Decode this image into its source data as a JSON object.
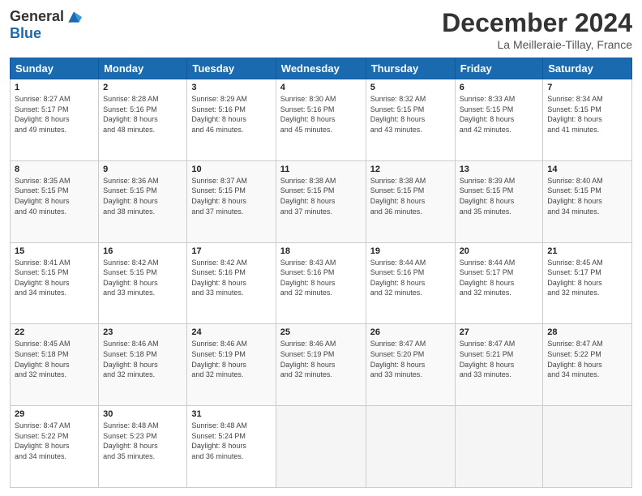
{
  "logo": {
    "general": "General",
    "blue": "Blue"
  },
  "header": {
    "month": "December 2024",
    "location": "La Meilleraie-Tillay, France"
  },
  "weekdays": [
    "Sunday",
    "Monday",
    "Tuesday",
    "Wednesday",
    "Thursday",
    "Friday",
    "Saturday"
  ],
  "weeks": [
    [
      {
        "day": "1",
        "info": "Sunrise: 8:27 AM\nSunset: 5:17 PM\nDaylight: 8 hours\nand 49 minutes."
      },
      {
        "day": "2",
        "info": "Sunrise: 8:28 AM\nSunset: 5:16 PM\nDaylight: 8 hours\nand 48 minutes."
      },
      {
        "day": "3",
        "info": "Sunrise: 8:29 AM\nSunset: 5:16 PM\nDaylight: 8 hours\nand 46 minutes."
      },
      {
        "day": "4",
        "info": "Sunrise: 8:30 AM\nSunset: 5:16 PM\nDaylight: 8 hours\nand 45 minutes."
      },
      {
        "day": "5",
        "info": "Sunrise: 8:32 AM\nSunset: 5:15 PM\nDaylight: 8 hours\nand 43 minutes."
      },
      {
        "day": "6",
        "info": "Sunrise: 8:33 AM\nSunset: 5:15 PM\nDaylight: 8 hours\nand 42 minutes."
      },
      {
        "day": "7",
        "info": "Sunrise: 8:34 AM\nSunset: 5:15 PM\nDaylight: 8 hours\nand 41 minutes."
      }
    ],
    [
      {
        "day": "8",
        "info": "Sunrise: 8:35 AM\nSunset: 5:15 PM\nDaylight: 8 hours\nand 40 minutes."
      },
      {
        "day": "9",
        "info": "Sunrise: 8:36 AM\nSunset: 5:15 PM\nDaylight: 8 hours\nand 38 minutes."
      },
      {
        "day": "10",
        "info": "Sunrise: 8:37 AM\nSunset: 5:15 PM\nDaylight: 8 hours\nand 37 minutes."
      },
      {
        "day": "11",
        "info": "Sunrise: 8:38 AM\nSunset: 5:15 PM\nDaylight: 8 hours\nand 37 minutes."
      },
      {
        "day": "12",
        "info": "Sunrise: 8:38 AM\nSunset: 5:15 PM\nDaylight: 8 hours\nand 36 minutes."
      },
      {
        "day": "13",
        "info": "Sunrise: 8:39 AM\nSunset: 5:15 PM\nDaylight: 8 hours\nand 35 minutes."
      },
      {
        "day": "14",
        "info": "Sunrise: 8:40 AM\nSunset: 5:15 PM\nDaylight: 8 hours\nand 34 minutes."
      }
    ],
    [
      {
        "day": "15",
        "info": "Sunrise: 8:41 AM\nSunset: 5:15 PM\nDaylight: 8 hours\nand 34 minutes."
      },
      {
        "day": "16",
        "info": "Sunrise: 8:42 AM\nSunset: 5:15 PM\nDaylight: 8 hours\nand 33 minutes."
      },
      {
        "day": "17",
        "info": "Sunrise: 8:42 AM\nSunset: 5:16 PM\nDaylight: 8 hours\nand 33 minutes."
      },
      {
        "day": "18",
        "info": "Sunrise: 8:43 AM\nSunset: 5:16 PM\nDaylight: 8 hours\nand 32 minutes."
      },
      {
        "day": "19",
        "info": "Sunrise: 8:44 AM\nSunset: 5:16 PM\nDaylight: 8 hours\nand 32 minutes."
      },
      {
        "day": "20",
        "info": "Sunrise: 8:44 AM\nSunset: 5:17 PM\nDaylight: 8 hours\nand 32 minutes."
      },
      {
        "day": "21",
        "info": "Sunrise: 8:45 AM\nSunset: 5:17 PM\nDaylight: 8 hours\nand 32 minutes."
      }
    ],
    [
      {
        "day": "22",
        "info": "Sunrise: 8:45 AM\nSunset: 5:18 PM\nDaylight: 8 hours\nand 32 minutes."
      },
      {
        "day": "23",
        "info": "Sunrise: 8:46 AM\nSunset: 5:18 PM\nDaylight: 8 hours\nand 32 minutes."
      },
      {
        "day": "24",
        "info": "Sunrise: 8:46 AM\nSunset: 5:19 PM\nDaylight: 8 hours\nand 32 minutes."
      },
      {
        "day": "25",
        "info": "Sunrise: 8:46 AM\nSunset: 5:19 PM\nDaylight: 8 hours\nand 32 minutes."
      },
      {
        "day": "26",
        "info": "Sunrise: 8:47 AM\nSunset: 5:20 PM\nDaylight: 8 hours\nand 33 minutes."
      },
      {
        "day": "27",
        "info": "Sunrise: 8:47 AM\nSunset: 5:21 PM\nDaylight: 8 hours\nand 33 minutes."
      },
      {
        "day": "28",
        "info": "Sunrise: 8:47 AM\nSunset: 5:22 PM\nDaylight: 8 hours\nand 34 minutes."
      }
    ],
    [
      {
        "day": "29",
        "info": "Sunrise: 8:47 AM\nSunset: 5:22 PM\nDaylight: 8 hours\nand 34 minutes."
      },
      {
        "day": "30",
        "info": "Sunrise: 8:48 AM\nSunset: 5:23 PM\nDaylight: 8 hours\nand 35 minutes."
      },
      {
        "day": "31",
        "info": "Sunrise: 8:48 AM\nSunset: 5:24 PM\nDaylight: 8 hours\nand 36 minutes."
      },
      null,
      null,
      null,
      null
    ]
  ]
}
